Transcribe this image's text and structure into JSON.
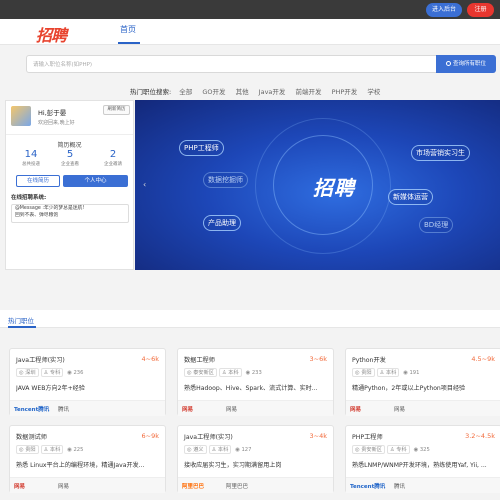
{
  "topbar": {
    "admin_label": "进入后台",
    "register_label": "注册"
  },
  "header": {
    "logo_text": "招聘",
    "nav_home": "首页"
  },
  "search": {
    "placeholder": "请输入职位名称(如PHP)",
    "button_label": "查询所有职位"
  },
  "hot_search": {
    "label": "热门职位搜索:",
    "items": [
      "全部",
      "GO开发",
      "其他",
      "Java开发",
      "前端开发",
      "PHP开发",
      "学校"
    ]
  },
  "user": {
    "greeting": "Hi,彭于晏",
    "welcome": "欢迎回来,晚上好",
    "refresh_label": "刷新简历",
    "resume_title": "简历概况",
    "stats": [
      {
        "num": "14",
        "label": "总共投递"
      },
      {
        "num": "5",
        "label": "企业查看"
      },
      {
        "num": "2",
        "label": "企业邀请"
      }
    ],
    "online_resume": "在线简历",
    "personal_center": "个人中心",
    "system_title": "在线招聘系统:",
    "message_line1": "@Message :年少的梦总是迷航!",
    "message_line2": "回到不表、弹尽粮饱"
  },
  "banner": {
    "center_text": "招聘",
    "tags": [
      "PHP工程师",
      "市场营销实习生",
      "数据挖掘师",
      "新媒体运营",
      "产品助理",
      "BD经理"
    ],
    "slide_index": 1,
    "slide_count": 4
  },
  "hot_jobs": {
    "title": "热门职位",
    "cards": [
      {
        "title": "Java工程师(实习)",
        "salary": "4~6k",
        "city": "深圳",
        "edu": "专科",
        "views": "236",
        "req": "JAVA WEB方向2年+经验",
        "company_logo": "Tencent腾讯",
        "company": "腾讯",
        "logo_color": "blue"
      },
      {
        "title": "数据工程师",
        "salary": "3~6k",
        "city": "泰安新区",
        "edu": "本科",
        "views": "233",
        "req": "熟悉Hadoop、Hive、Spark、流式计算、实时...",
        "company_logo": "网易",
        "company": "网易",
        "logo_color": "red"
      },
      {
        "title": "Python开发",
        "salary": "4.5~9k",
        "city": "贵阳",
        "edu": "本科",
        "views": "191",
        "req": "精通Python，2年或以上Python项目经验",
        "company_logo": "网易",
        "company": "网易",
        "logo_color": "red"
      },
      {
        "title": "数据测试师",
        "salary": "6~9k",
        "city": "贵阳",
        "edu": "本科",
        "views": "225",
        "req": "熟悉 Linux平台上的编程环境，精通Java开发...",
        "company_logo": "网易",
        "company": "网易",
        "logo_color": "red"
      },
      {
        "title": "Java工程师(实习)",
        "salary": "3~4k",
        "city": "遵义",
        "edu": "本科",
        "views": "127",
        "req": "接收应届实习生，实习期满留用上岗",
        "company_logo": "阿里巴巴",
        "company": "阿里巴巴",
        "logo_color": "orange"
      },
      {
        "title": "PHP工程师",
        "salary": "3.2~4.5k",
        "city": "贵安新区",
        "edu": "专科",
        "views": "325",
        "req": "熟悉LNMP/WNMP开发环境，熟练使用Yaf, Yii, ...",
        "company_logo": "Tencent腾讯",
        "company": "腾讯",
        "logo_color": "blue"
      }
    ]
  }
}
